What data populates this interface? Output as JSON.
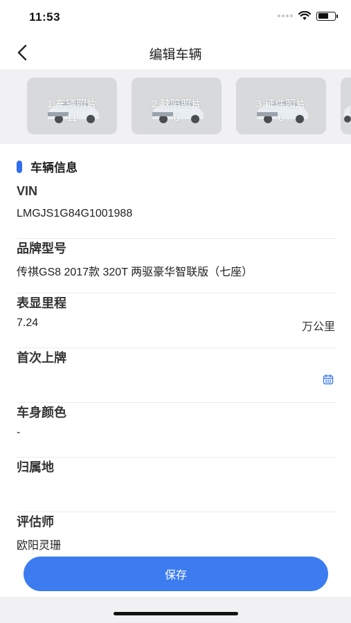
{
  "status_bar": {
    "time": "11:53"
  },
  "nav": {
    "title": "编辑车辆"
  },
  "photos": [
    {
      "label": "1.车辆照片",
      "count": "11"
    },
    {
      "label": "2.缺陷照片",
      "count": "0"
    },
    {
      "label": "3.证件照片",
      "count": "0"
    },
    {
      "label": "",
      "count": ""
    }
  ],
  "section": {
    "title": "车辆信息",
    "accent_color": "#2f6ff0"
  },
  "fields": {
    "vin": {
      "label": "VIN",
      "value": "LMGJS1G84G1001988"
    },
    "model": {
      "label": "品牌型号",
      "value": "传祺GS8 2017款 320T 两驱豪华智联版（七座）"
    },
    "mileage": {
      "label": "表显里程",
      "value": "7.24",
      "unit": "万公里"
    },
    "first_registration": {
      "label": "首次上牌",
      "value": ""
    },
    "color": {
      "label": "车身颜色",
      "value": "-"
    },
    "location": {
      "label": "归属地",
      "value": ""
    },
    "appraiser": {
      "label": "评估师",
      "value": "欧阳灵珊"
    }
  },
  "save_button": {
    "label": "保存",
    "color": "#3c7cf0"
  }
}
